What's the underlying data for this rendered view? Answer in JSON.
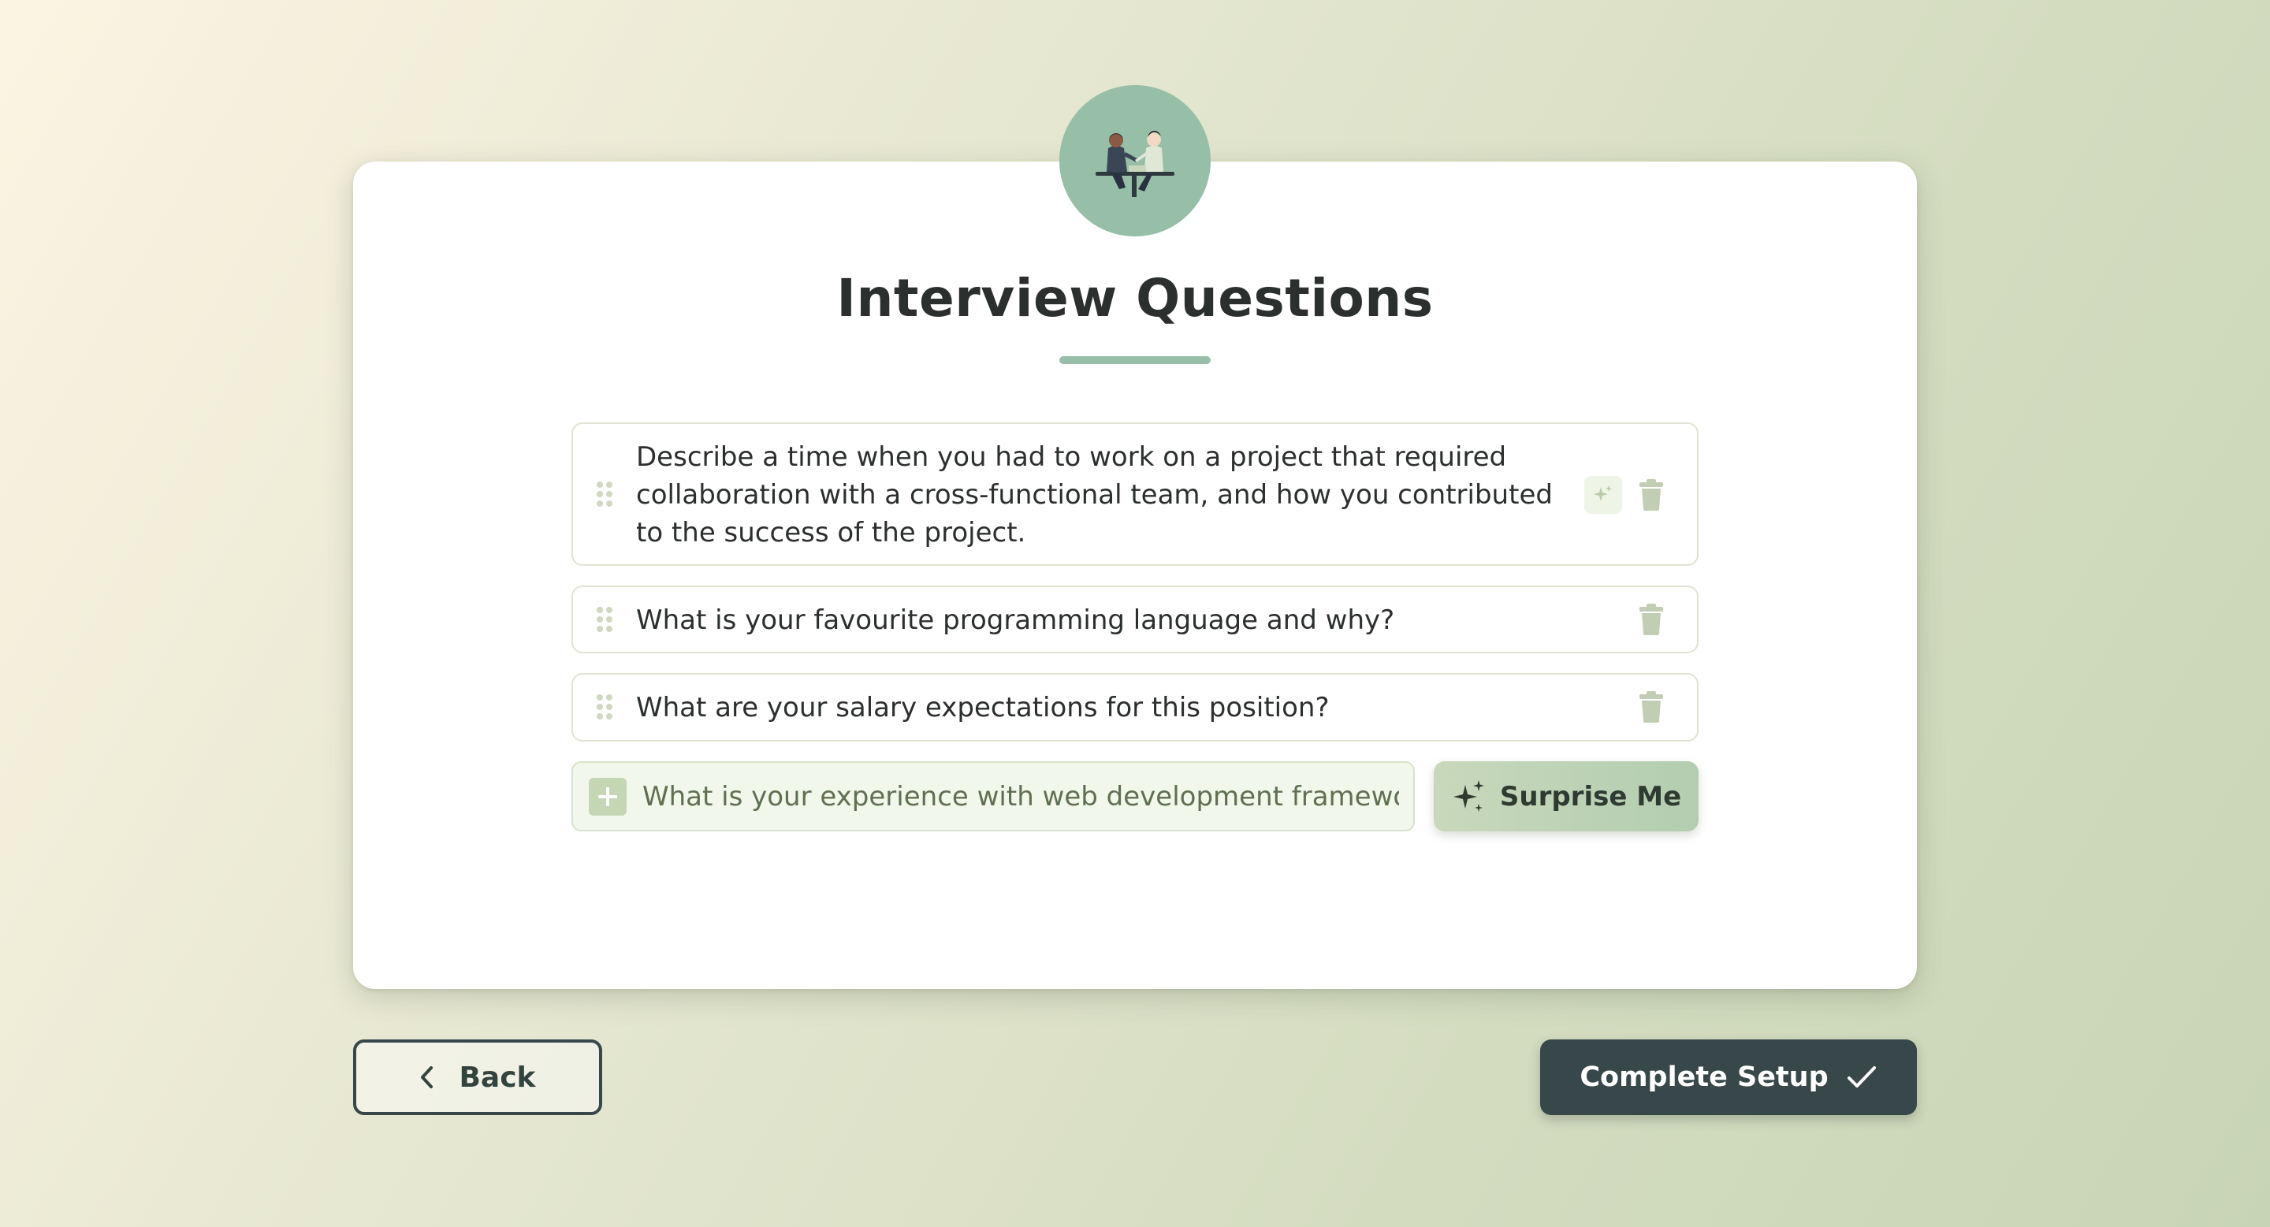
{
  "header": {
    "title": "Interview Questions",
    "illustration_icon": "handshake-meeting-illustration"
  },
  "questions": [
    {
      "text": "Describe a time when you had to work on a project that required collaboration with a cross-functional team, and how you contributed to the success of the project.",
      "has_ai_icon": true
    },
    {
      "text": "What is your favourite programming language and why?",
      "has_ai_icon": false
    },
    {
      "text": "What are your salary expectations for this position?",
      "has_ai_icon": false
    }
  ],
  "new_question": {
    "placeholder": "What is your experience with web development frameworks?",
    "value": ""
  },
  "actions": {
    "surprise_label": "Surprise Me",
    "back_label": "Back",
    "complete_label": "Complete Setup"
  },
  "colors": {
    "accent": "#97bfa8",
    "dark_button": "#37474a",
    "surprise_button": "#b8cfb2",
    "row_border": "#dfe5d2"
  }
}
